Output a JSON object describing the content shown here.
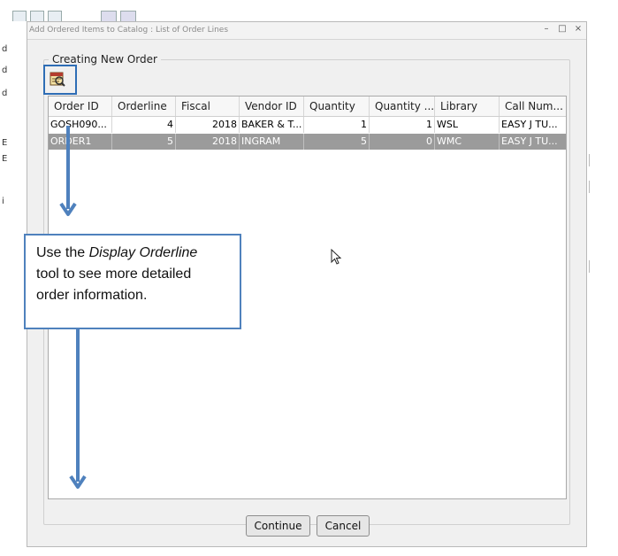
{
  "window": {
    "title": "Add Ordered Items to Catalog : List of Order Lines",
    "minimize": "–",
    "maximize": "□",
    "close": "×"
  },
  "group": {
    "legend": "Creating New Order"
  },
  "toolbar": {
    "display_orderline_icon": "display-orderline-icon"
  },
  "table": {
    "columns": [
      "Order ID",
      "Orderline",
      "Fiscal",
      "Vendor ID",
      "Quantity",
      "Quantity ...",
      "Library",
      "Call Num..."
    ],
    "rows": [
      [
        "GOSH090...",
        "4",
        "2018",
        "BAKER & T...",
        "1",
        "1",
        "WSL",
        "EASY J TU..."
      ],
      [
        "ORDER1",
        "5",
        "2018",
        "INGRAM",
        "5",
        "0",
        "WMC",
        "EASY J TU..."
      ]
    ],
    "selected_row": 1
  },
  "buttons": {
    "continue": "Continue",
    "cancel": "Cancel"
  },
  "callout": {
    "line1_prefix": "Use the ",
    "line1_italic": "Display Orderline",
    "line2": "tool to see more detailed",
    "line3": "order information."
  },
  "colors": {
    "accent": "#2e6db5",
    "callout_border": "#4f81bd",
    "selected_row": "#9b9b9b"
  },
  "left_edge_glyphs": [
    "d",
    "d",
    "d",
    "E",
    "E",
    "i"
  ]
}
